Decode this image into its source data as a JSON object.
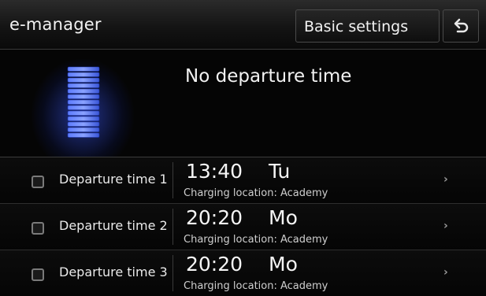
{
  "header": {
    "title": "e-manager",
    "settings_button": "Basic settings",
    "back_icon": "back-arrow-icon"
  },
  "summary": {
    "text": "No departure time",
    "icon": "battery-icon",
    "accent_color": "#3a5cff"
  },
  "departure_times": [
    {
      "label": "Departure time 1",
      "time": "13:40",
      "day": "Tu",
      "location": "Charging location: Academy",
      "checked": false
    },
    {
      "label": "Departure time 2",
      "time": "20:20",
      "day": "Mo",
      "location": "Charging location: Academy",
      "checked": false
    },
    {
      "label": "Departure time 3",
      "time": "20:20",
      "day": "Mo",
      "location": "Charging location: Academy",
      "checked": false
    }
  ]
}
